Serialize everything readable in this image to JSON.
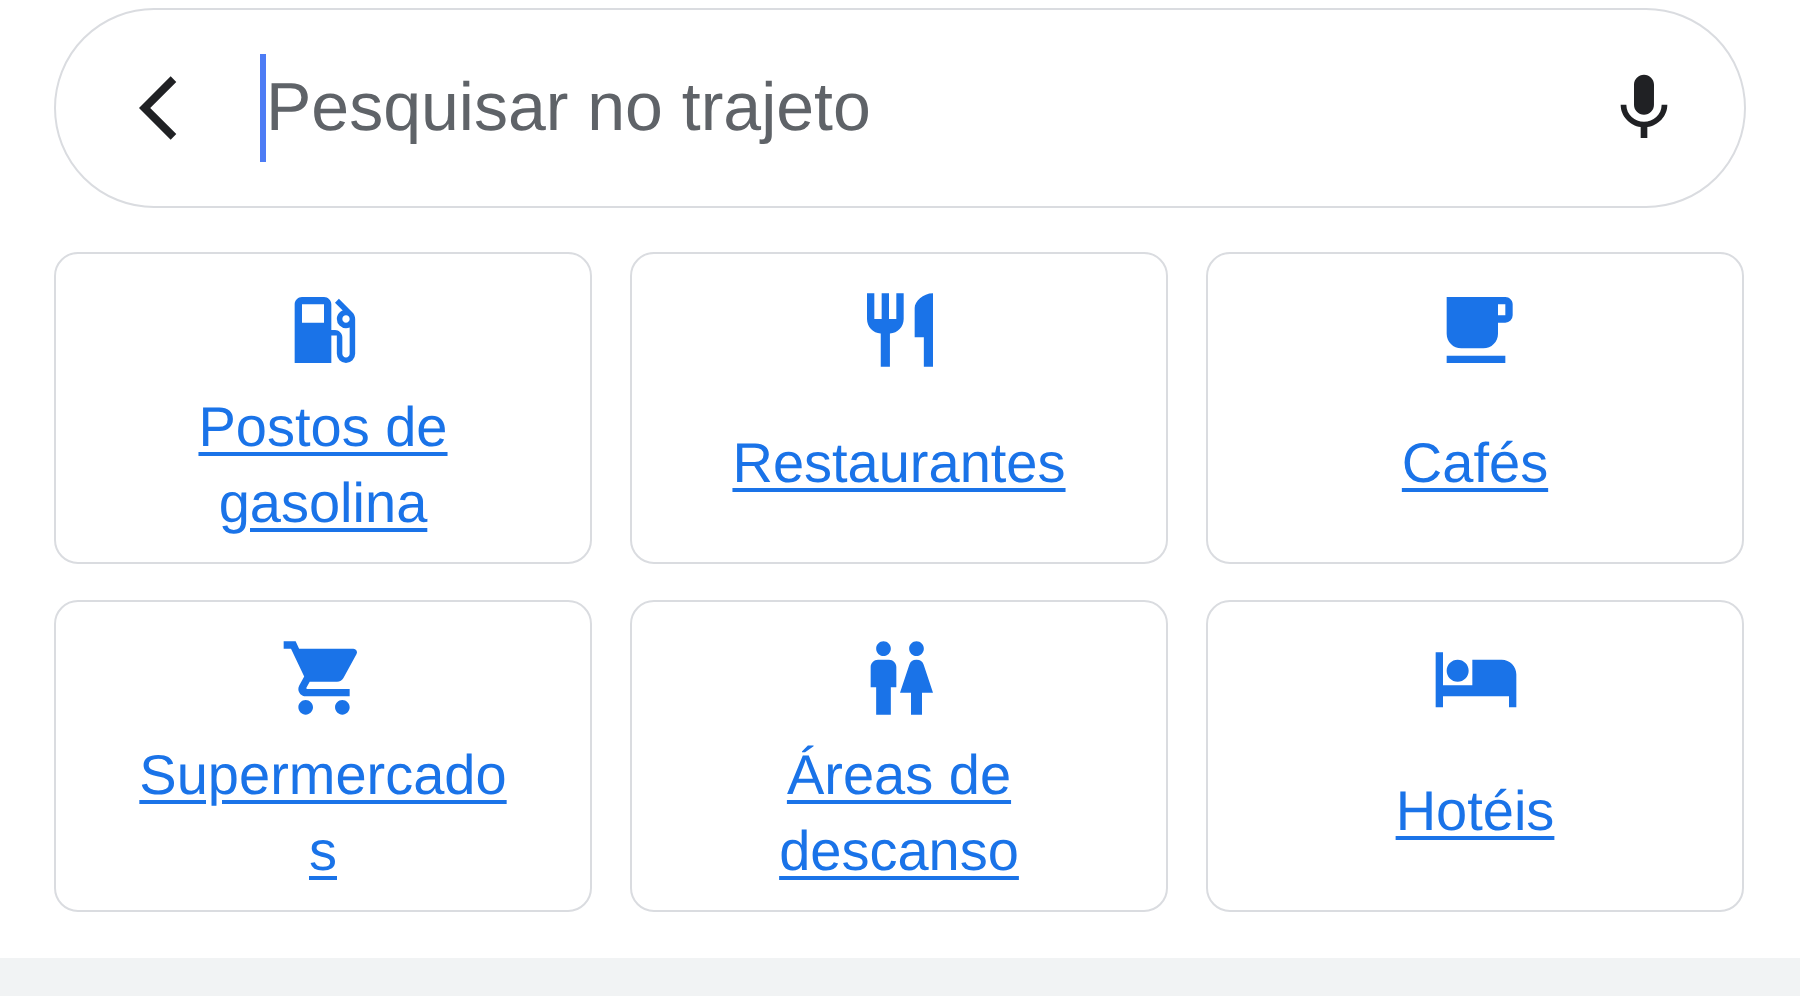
{
  "search": {
    "placeholder": "Pesquisar no trajeto"
  },
  "categories": [
    {
      "kind": "gas",
      "label": "Postos de gasolina"
    },
    {
      "kind": "restaurant",
      "label": "Restaurantes"
    },
    {
      "kind": "cafe",
      "label": "Cafés"
    },
    {
      "kind": "cart",
      "label": "Supermercados"
    },
    {
      "kind": "restroom",
      "label": "Áreas de descanso"
    },
    {
      "kind": "hotel",
      "label": "Hotéis"
    }
  ]
}
